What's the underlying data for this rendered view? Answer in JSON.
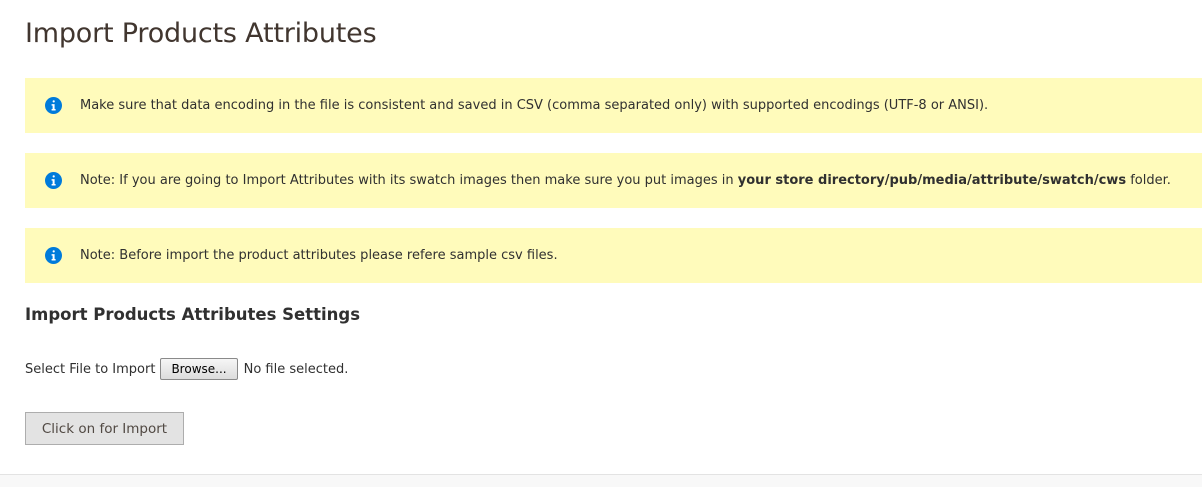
{
  "page": {
    "title": "Import Products Attributes"
  },
  "notices": [
    {
      "icon": "info-icon",
      "text": "Make sure that data encoding in the file is consistent and saved in CSV (comma separated only) with supported encodings (UTF-8 or ANSI)."
    },
    {
      "icon": "info-icon",
      "text_before": "Note: If you are going to Import Attributes with its swatch images then make sure you put images in ",
      "text_bold": "your store directory/pub/media/attribute/swatch/cws",
      "text_after": " folder."
    },
    {
      "icon": "info-icon",
      "text": "Note: Before import the product attributes please refere sample csv files."
    }
  ],
  "settings": {
    "title": "Import Products Attributes Settings",
    "file_label": "Select File to Import",
    "browse_label": "Browse...",
    "no_file_text": "No file selected.",
    "import_button_label": "Click on for Import"
  },
  "colors": {
    "notice_background": "#fffbbb",
    "info_icon": "#007bdb",
    "title_text": "#41362f",
    "button_background": "#e3e3e3"
  }
}
